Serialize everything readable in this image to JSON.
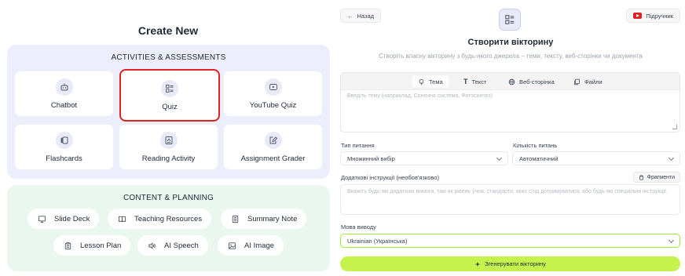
{
  "left": {
    "title": "Create New",
    "activities": {
      "heading": "ACTIVITIES & ASSESSMENTS",
      "items": [
        {
          "label": "Chatbot",
          "icon": "bot-icon"
        },
        {
          "label": "Quiz",
          "icon": "quiz-list-icon",
          "selected": true
        },
        {
          "label": "YouTube Quiz",
          "icon": "youtube-play-icon"
        },
        {
          "label": "Flashcards",
          "icon": "flashcards-icon"
        },
        {
          "label": "Reading Activity",
          "icon": "reading-doc-icon"
        },
        {
          "label": "Assignment Grader",
          "icon": "grader-edit-icon"
        }
      ]
    },
    "content": {
      "heading": "CONTENT & PLANNING",
      "items": [
        {
          "label": "Slide Deck",
          "icon": "monitor-icon"
        },
        {
          "label": "Teaching Resources",
          "icon": "book-open-icon"
        },
        {
          "label": "Summary Note",
          "icon": "note-icon"
        },
        {
          "label": "Lesson Plan",
          "icon": "clipboard-icon"
        },
        {
          "label": "AI Speech",
          "icon": "speaker-icon"
        },
        {
          "label": "AI Image",
          "icon": "image-icon"
        }
      ]
    }
  },
  "right": {
    "back_label": "Назад",
    "guide_label": "Підручник",
    "title": "Створити вікторину",
    "subtitle": "Створіть власну вікторину з будь-якого джерела – теми, тексту, веб-сторінки чи документа",
    "tabs": [
      {
        "label": "Тема",
        "icon": "lightbulb-icon",
        "active": true
      },
      {
        "label": "Текст",
        "icon": "text-icon"
      },
      {
        "label": "Веб-сторінка",
        "icon": "globe-icon"
      },
      {
        "label": "Файли",
        "icon": "files-icon"
      }
    ],
    "source_placeholder": "Введіть тему (наприклад, Сонячна система, Фотосинтез)",
    "question_type": {
      "label": "Тип питання",
      "value": "Множинний вибір"
    },
    "question_count": {
      "label": "Кількість питань",
      "value": "Автоматичний"
    },
    "instructions": {
      "label": "Додаткові інструкції (необов'язково)",
      "fragments_label": "Фрагменти",
      "placeholder": "Вкажіть будь-які додаткові вимоги, такі як рівень учня, стандарти, яких слід дотримуватися, або будь-які спеціальні інструкції."
    },
    "output_language": {
      "label": "Мова виводу",
      "value": "Ukrainian (Українська)"
    },
    "generate_label": "Згенерувати вікторину"
  },
  "colors": {
    "accent_lime": "#c6f24e",
    "activities_bg": "#eceffb",
    "content_bg": "#e9f7ee",
    "selected_border": "#e02424",
    "youtube_red": "#e02424"
  }
}
